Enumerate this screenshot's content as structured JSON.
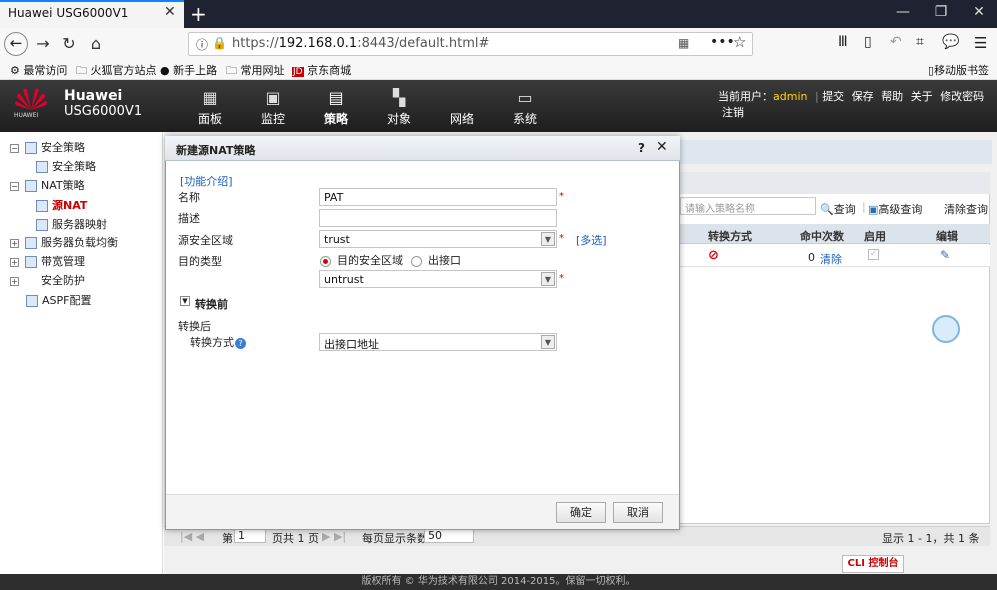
{
  "browser": {
    "tab_title": "Huawei USG6000V1",
    "url_prefix": "https://",
    "url_host": "192.168.0.1",
    "url_rest": ":8443/default.html#",
    "bookmarks": [
      "最常访问",
      "火狐官方站点",
      "新手上路",
      "常用网址",
      "京东商城"
    ],
    "mobile_bookmarks": "移动版书签"
  },
  "header": {
    "brand": "Huawei",
    "model": "USG6000V1",
    "logo_text": "HUAWEI",
    "menus": [
      "面板",
      "监控",
      "策略",
      "对象",
      "网络",
      "系统"
    ],
    "current_user_label": "当前用户：",
    "current_user": "admin",
    "actions": [
      "提交",
      "保存",
      "帮助",
      "关于",
      "修改密码",
      "注销"
    ]
  },
  "sidebar": {
    "items": [
      {
        "label": "安全策略"
      },
      {
        "label": "安全策略"
      },
      {
        "label": "NAT策略"
      },
      {
        "label": "源NAT"
      },
      {
        "label": "服务器映射"
      },
      {
        "label": "服务器负载均衡"
      },
      {
        "label": "带宽管理"
      },
      {
        "label": "安全防护"
      },
      {
        "label": "ASPF配置"
      }
    ]
  },
  "main": {
    "search_placeholder": "请输入策略名称",
    "search_label": "查询",
    "advanced_search": "高级查询",
    "clear_search": "清除查询",
    "columns": [
      "转换方式",
      "命中次数",
      "启用",
      "编辑"
    ],
    "row": {
      "hits": "0",
      "clear": "清除"
    },
    "pager": {
      "first": "第",
      "page": "1",
      "total": "页共 1 页",
      "per_page_label": "每页显示条数",
      "per_page": "50"
    },
    "summary": "显示 1 - 1，共 1 条",
    "cli": "CLI 控制台"
  },
  "dialog": {
    "title": "新建源NAT策略",
    "help": "?",
    "intro_link": "[功能介绍]",
    "fields": {
      "name_label": "名称",
      "name_value": "PAT",
      "desc_label": "描述",
      "desc_value": "",
      "src_zone_label": "源安全区域",
      "src_zone_value": "trust",
      "multi_select": "[多选]",
      "dst_type_label": "目的类型",
      "radio_zone": "目的安全区域",
      "radio_iface": "出接口",
      "dst_zone_value": "untrust",
      "before_section": "转换前",
      "after_section": "转换后",
      "mode_label": "转换方式",
      "mode_value": "出接口地址"
    },
    "ok": "确定",
    "cancel": "取消"
  },
  "footer": "版权所有 © 华为技术有限公司 2014-2015。保留一切权利。"
}
